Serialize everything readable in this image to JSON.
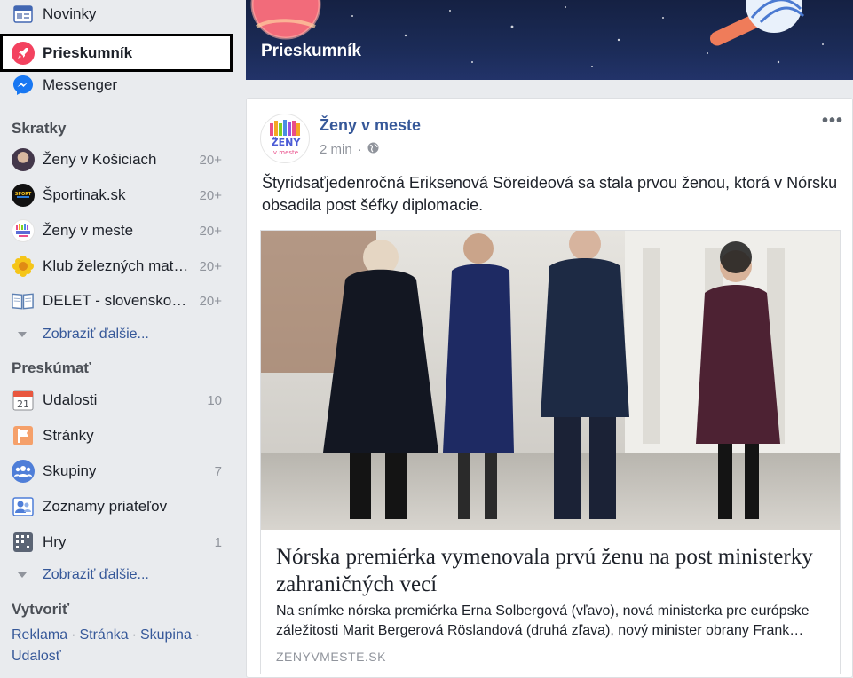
{
  "sidebar": {
    "top_items": [
      {
        "label": "Novinky",
        "icon": "news-feed-icon"
      },
      {
        "label": "Prieskumník",
        "icon": "rocket-icon"
      },
      {
        "label": "Messenger",
        "icon": "messenger-icon"
      }
    ],
    "shortcuts_title": "Skratky",
    "shortcuts": [
      {
        "label": "Ženy v Košiciach",
        "count": "20+"
      },
      {
        "label": "Športinak.sk",
        "count": "20+"
      },
      {
        "label": "Ženy v meste",
        "count": "20+"
      },
      {
        "label": "Klub železných mat…",
        "count": "20+"
      },
      {
        "label": "DELET - slovensko…",
        "count": "20+"
      }
    ],
    "show_more_1": "Zobraziť ďalšie...",
    "explore_title": "Preskúmať",
    "explore": [
      {
        "label": "Udalosti",
        "count": "10",
        "icon": "calendar-icon",
        "icon_text": "21"
      },
      {
        "label": "Stránky",
        "count": "",
        "icon": "flag-icon"
      },
      {
        "label": "Skupiny",
        "count": "7",
        "icon": "groups-icon"
      },
      {
        "label": "Zoznamy priateľov",
        "count": "",
        "icon": "friend-list-icon"
      },
      {
        "label": "Hry",
        "count": "1",
        "icon": "games-icon"
      }
    ],
    "show_more_2": "Zobraziť ďalšie...",
    "create_title": "Vytvoriť",
    "create_links": [
      "Reklama",
      "Stránka",
      "Skupina",
      "Udalosť"
    ],
    "separator": "·"
  },
  "banner": {
    "title": "Prieskumník"
  },
  "post": {
    "page_name": "Ženy v meste",
    "time": "2 min",
    "time_separator": "·",
    "more_label": "•••",
    "avatar_text_top": "ŽENY",
    "avatar_text_bottom": "v meste",
    "text": "Štyridsaťjedenročná Eriksenová Söreideová sa stala prvou ženou, ktorá v Nórsku obsadila post šéfky diplomacie.",
    "link": {
      "title": "Nórska premiérka vymenovala prvú ženu na post ministerky zahraničných vecí",
      "description": "Na snímke nórska premiérka Erna Solbergová (vľavo), nová ministerka pre európske záležitosti Marit Bergerová Röslandová (druhá zľava), nový minister obrany Frank…",
      "source": "ZENYVMESTE.SK"
    }
  },
  "colors": {
    "link_blue": "#365899",
    "bg": "#e9ebee",
    "meta_gray": "#90949c"
  }
}
